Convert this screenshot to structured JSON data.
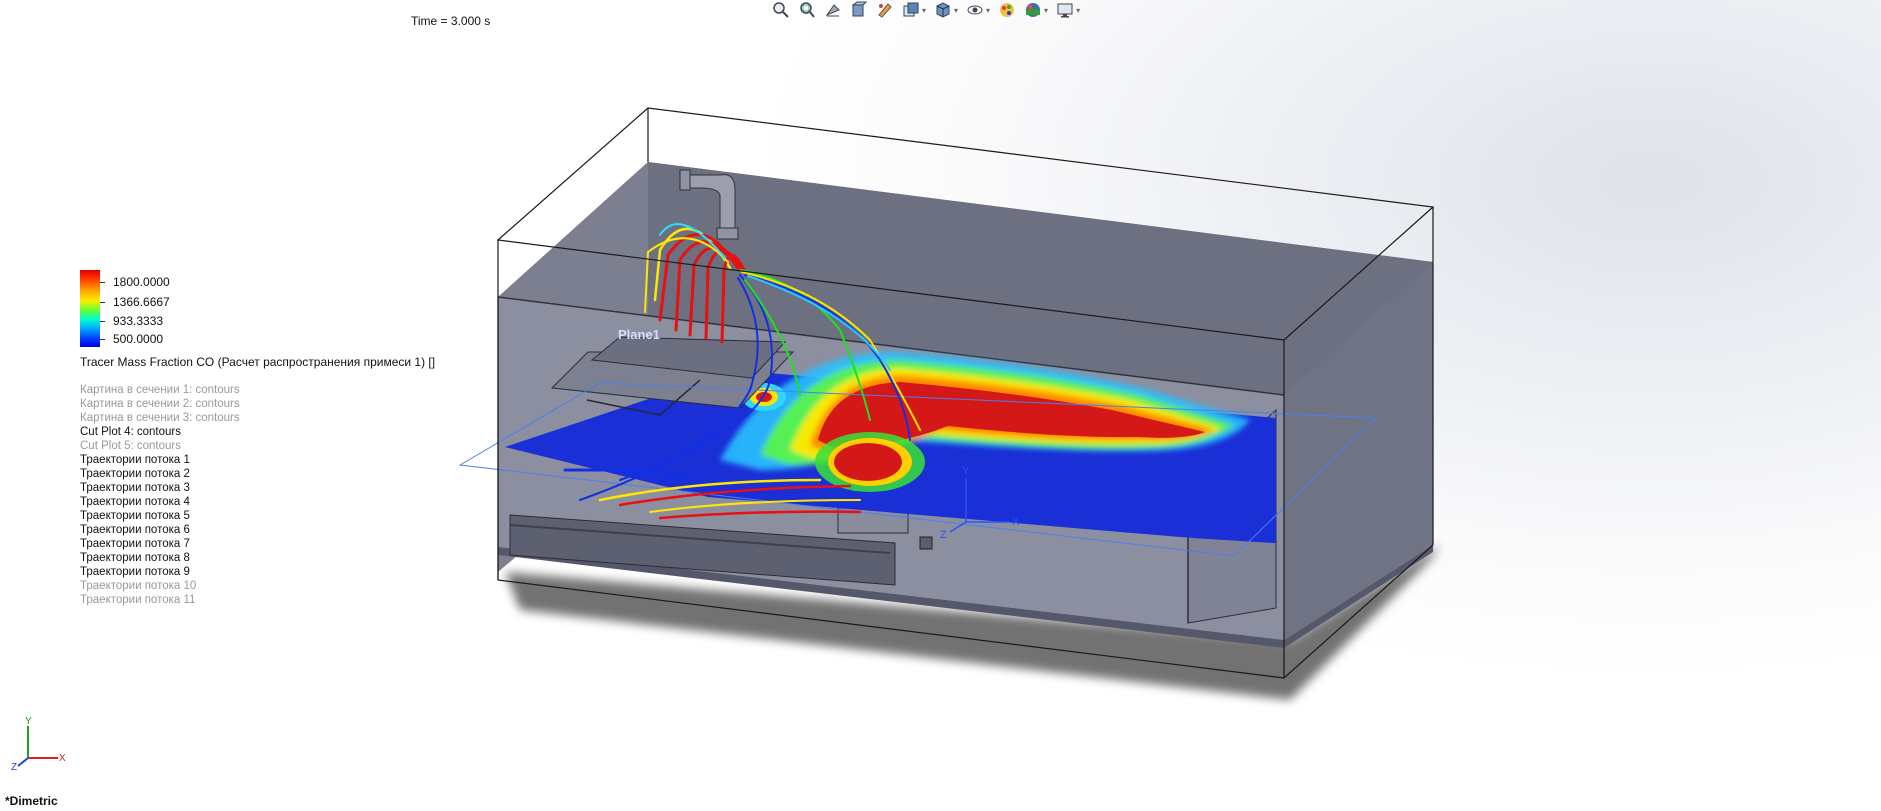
{
  "time_label": "Time = 3.000 s",
  "toolbar": {
    "icons": [
      "zoom-to-fit-icon",
      "zoom-to-area-icon",
      "previous-view-icon",
      "section-view-icon",
      "dynamic-annotation-icon",
      "view-orientation-icon",
      "display-style-icon",
      "hide-show-icon",
      "edit-appearance-icon",
      "apply-scene-icon",
      "view-settings-icon"
    ]
  },
  "legend": {
    "max": "1800.0000",
    "v2": "1366.6667",
    "v3": "933.3333",
    "min": "500.0000",
    "title": "Tracer Mass Fraction CO (Расчет распространения примеси 1) []",
    "colors": [
      "#e00000",
      "#ff9900",
      "#ffee00",
      "#66ff33",
      "#00ffcc",
      "#00aaff",
      "#0000e0"
    ]
  },
  "features": [
    {
      "label": "Картина в сечении 1: contours",
      "active": false
    },
    {
      "label": "Картина в сечении 2: contours",
      "active": false
    },
    {
      "label": "Картина в сечении 3: contours",
      "active": false
    },
    {
      "label": "Cut Plot 4: contours",
      "active": true
    },
    {
      "label": "Cut Plot 5: contours",
      "active": false
    },
    {
      "label": "Траектории потока 1",
      "active": true
    },
    {
      "label": "Траектории потока 2",
      "active": true
    },
    {
      "label": "Траектории потока 3",
      "active": true
    },
    {
      "label": "Траектории потока 4",
      "active": true
    },
    {
      "label": "Траектории потока 5",
      "active": true
    },
    {
      "label": "Траектории потока 6",
      "active": true
    },
    {
      "label": "Траектории потока 7",
      "active": true
    },
    {
      "label": "Траектории потока 8",
      "active": true
    },
    {
      "label": "Траектории потока 9",
      "active": true
    },
    {
      "label": "Траектории потока 10",
      "active": false
    },
    {
      "label": "Траектории потока 11",
      "active": false
    }
  ],
  "scene": {
    "plane_label": "Plane1",
    "axis_x": "X",
    "axis_y": "Y",
    "axis_z": "Z"
  },
  "triad": {
    "x": "X",
    "y": "Y",
    "z": "Z"
  },
  "view_name": "*Dimetric"
}
